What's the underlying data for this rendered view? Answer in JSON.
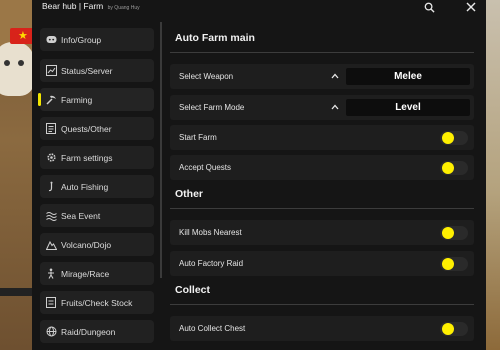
{
  "window": {
    "title": "Bear hub | Farm",
    "subtitle": "by Quang Huy",
    "search_icon": "search-icon",
    "close_icon": "close-icon"
  },
  "sidebar": {
    "items": [
      {
        "label": "Info/Group",
        "icon": "discord-icon",
        "active": false
      },
      {
        "label": "Status/Server",
        "icon": "chart-icon",
        "active": false
      },
      {
        "label": "Farming",
        "icon": "pickaxe-icon",
        "active": true
      },
      {
        "label": "Quests/Other",
        "icon": "document-icon",
        "active": false
      },
      {
        "label": "Farm settings",
        "icon": "gear-icon",
        "active": false
      },
      {
        "label": "Auto Fishing",
        "icon": "fish-icon",
        "active": false
      },
      {
        "label": "Sea Event",
        "icon": "waves-icon",
        "active": false
      },
      {
        "label": "Volcano/Dojo",
        "icon": "mountain-icon",
        "active": false
      },
      {
        "label": "Mirage/Race",
        "icon": "figure-icon",
        "active": false
      },
      {
        "label": "Fruits/Check Stock",
        "icon": "fruit-icon",
        "active": false
      },
      {
        "label": "Raid/Dungeon",
        "icon": "globe-icon",
        "active": false
      }
    ]
  },
  "main": {
    "sections": [
      {
        "title": "Auto Farm main",
        "rows": [
          {
            "label": "Select Weapon",
            "type": "dropdown",
            "value": "Melee"
          },
          {
            "label": "Select Farm Mode",
            "type": "dropdown",
            "value": "Level"
          },
          {
            "label": "Start Farm",
            "type": "toggle",
            "on": true
          },
          {
            "label": "Accept Quests",
            "type": "toggle",
            "on": true
          }
        ]
      },
      {
        "title": "Other",
        "rows": [
          {
            "label": "Kill Mobs Nearest",
            "type": "toggle",
            "on": true
          },
          {
            "label": "Auto Factory Raid",
            "type": "toggle",
            "on": true
          }
        ]
      },
      {
        "title": "Collect",
        "rows": [
          {
            "label": "Auto Collect Chest",
            "type": "toggle",
            "on": true
          }
        ]
      }
    ]
  },
  "colors": {
    "accent": "#f3e600",
    "window_bg": "#151515",
    "row_bg": "#1e1e1e",
    "nav_bg": "#212121"
  }
}
